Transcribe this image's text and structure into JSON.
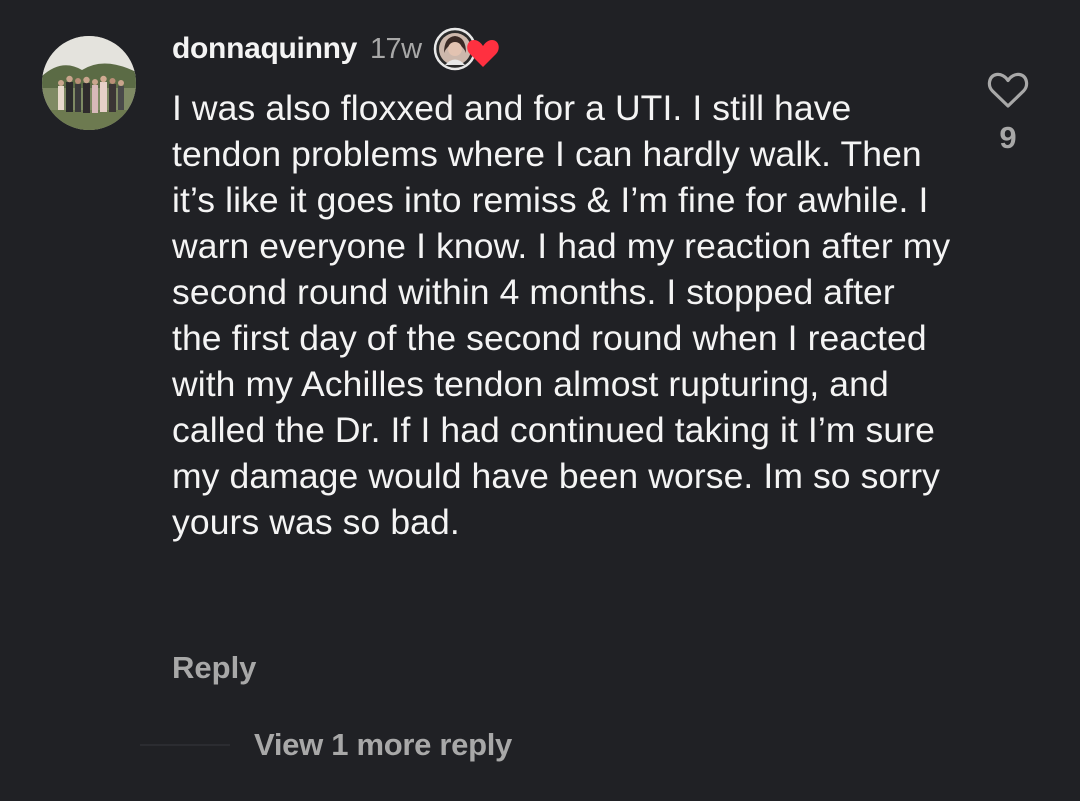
{
  "comment": {
    "username": "donnaquinny",
    "timestamp": "17w",
    "badge_icon": "creator-liked-heart-icon",
    "text": "I was also floxxed and for a UTI. I still have tendon problems where I can hardly walk. Then it’s like it goes into remiss & I’m fine for awhile. I warn everyone I know. I had my reaction after my second round within 4 months. I stopped after the first day of the second round when I reacted with my Achilles tendon almost rupturing, and called the Dr. If I had continued taking it I’m sure my damage would have been worse. Im so sorry yours was so bad.",
    "reply_label": "Reply",
    "like_count": "9",
    "like_icon": "heart-outline-icon"
  },
  "replies": {
    "view_label": "View 1 more reply"
  },
  "colors": {
    "background": "#202125",
    "primary_text": "#f4f4f4",
    "secondary_text": "#a8a8a8",
    "heart_red": "#ff3040"
  }
}
